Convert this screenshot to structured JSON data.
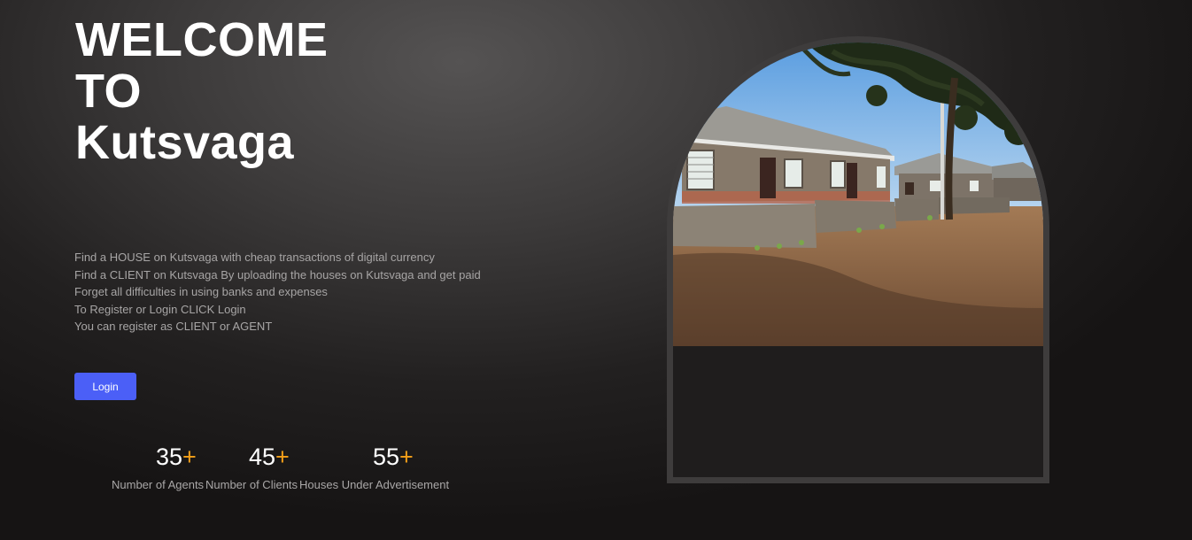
{
  "hero": {
    "title_lines": [
      "WELCOME",
      "TO",
      "Kutsvaga"
    ]
  },
  "description": [
    "Find a HOUSE on Kutsvaga with cheap transactions of digital currency",
    "Find a CLIENT on Kutsvaga By uploading the houses on Kutsvaga and get paid",
    "Forget all difficulties in using banks and expenses",
    "To Register or Login CLICK Login",
    "You can register as CLIENT or AGENT"
  ],
  "login_button": {
    "label": "Login"
  },
  "stats": [
    {
      "value": "35",
      "suffix": "+",
      "label": "Number of Agents"
    },
    {
      "value": "45",
      "suffix": "+",
      "label": "Number of Clients"
    },
    {
      "value": "55",
      "suffix": "+",
      "label": "Houses Under Advertisement"
    }
  ],
  "colors": {
    "accent": "#4b5ff7",
    "plus": "#f4a019",
    "text_muted": "#a7a5a5",
    "frame": "#3e3c3c"
  }
}
